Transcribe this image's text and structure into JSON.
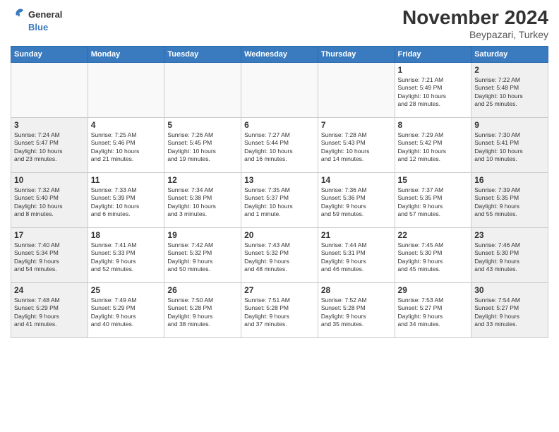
{
  "logo": {
    "general": "General",
    "blue": "Blue"
  },
  "header": {
    "month": "November 2024",
    "location": "Beypazari, Turkey"
  },
  "weekdays": [
    "Sunday",
    "Monday",
    "Tuesday",
    "Wednesday",
    "Thursday",
    "Friday",
    "Saturday"
  ],
  "weeks": [
    [
      {
        "day": "",
        "info": ""
      },
      {
        "day": "",
        "info": ""
      },
      {
        "day": "",
        "info": ""
      },
      {
        "day": "",
        "info": ""
      },
      {
        "day": "",
        "info": ""
      },
      {
        "day": "1",
        "info": "Sunrise: 7:21 AM\nSunset: 5:49 PM\nDaylight: 10 hours\nand 28 minutes."
      },
      {
        "day": "2",
        "info": "Sunrise: 7:22 AM\nSunset: 5:48 PM\nDaylight: 10 hours\nand 25 minutes."
      }
    ],
    [
      {
        "day": "3",
        "info": "Sunrise: 7:24 AM\nSunset: 5:47 PM\nDaylight: 10 hours\nand 23 minutes."
      },
      {
        "day": "4",
        "info": "Sunrise: 7:25 AM\nSunset: 5:46 PM\nDaylight: 10 hours\nand 21 minutes."
      },
      {
        "day": "5",
        "info": "Sunrise: 7:26 AM\nSunset: 5:45 PM\nDaylight: 10 hours\nand 19 minutes."
      },
      {
        "day": "6",
        "info": "Sunrise: 7:27 AM\nSunset: 5:44 PM\nDaylight: 10 hours\nand 16 minutes."
      },
      {
        "day": "7",
        "info": "Sunrise: 7:28 AM\nSunset: 5:43 PM\nDaylight: 10 hours\nand 14 minutes."
      },
      {
        "day": "8",
        "info": "Sunrise: 7:29 AM\nSunset: 5:42 PM\nDaylight: 10 hours\nand 12 minutes."
      },
      {
        "day": "9",
        "info": "Sunrise: 7:30 AM\nSunset: 5:41 PM\nDaylight: 10 hours\nand 10 minutes."
      }
    ],
    [
      {
        "day": "10",
        "info": "Sunrise: 7:32 AM\nSunset: 5:40 PM\nDaylight: 10 hours\nand 8 minutes."
      },
      {
        "day": "11",
        "info": "Sunrise: 7:33 AM\nSunset: 5:39 PM\nDaylight: 10 hours\nand 6 minutes."
      },
      {
        "day": "12",
        "info": "Sunrise: 7:34 AM\nSunset: 5:38 PM\nDaylight: 10 hours\nand 3 minutes."
      },
      {
        "day": "13",
        "info": "Sunrise: 7:35 AM\nSunset: 5:37 PM\nDaylight: 10 hours\nand 1 minute."
      },
      {
        "day": "14",
        "info": "Sunrise: 7:36 AM\nSunset: 5:36 PM\nDaylight: 9 hours\nand 59 minutes."
      },
      {
        "day": "15",
        "info": "Sunrise: 7:37 AM\nSunset: 5:35 PM\nDaylight: 9 hours\nand 57 minutes."
      },
      {
        "day": "16",
        "info": "Sunrise: 7:39 AM\nSunset: 5:35 PM\nDaylight: 9 hours\nand 55 minutes."
      }
    ],
    [
      {
        "day": "17",
        "info": "Sunrise: 7:40 AM\nSunset: 5:34 PM\nDaylight: 9 hours\nand 54 minutes."
      },
      {
        "day": "18",
        "info": "Sunrise: 7:41 AM\nSunset: 5:33 PM\nDaylight: 9 hours\nand 52 minutes."
      },
      {
        "day": "19",
        "info": "Sunrise: 7:42 AM\nSunset: 5:32 PM\nDaylight: 9 hours\nand 50 minutes."
      },
      {
        "day": "20",
        "info": "Sunrise: 7:43 AM\nSunset: 5:32 PM\nDaylight: 9 hours\nand 48 minutes."
      },
      {
        "day": "21",
        "info": "Sunrise: 7:44 AM\nSunset: 5:31 PM\nDaylight: 9 hours\nand 46 minutes."
      },
      {
        "day": "22",
        "info": "Sunrise: 7:45 AM\nSunset: 5:30 PM\nDaylight: 9 hours\nand 45 minutes."
      },
      {
        "day": "23",
        "info": "Sunrise: 7:46 AM\nSunset: 5:30 PM\nDaylight: 9 hours\nand 43 minutes."
      }
    ],
    [
      {
        "day": "24",
        "info": "Sunrise: 7:48 AM\nSunset: 5:29 PM\nDaylight: 9 hours\nand 41 minutes."
      },
      {
        "day": "25",
        "info": "Sunrise: 7:49 AM\nSunset: 5:29 PM\nDaylight: 9 hours\nand 40 minutes."
      },
      {
        "day": "26",
        "info": "Sunrise: 7:50 AM\nSunset: 5:28 PM\nDaylight: 9 hours\nand 38 minutes."
      },
      {
        "day": "27",
        "info": "Sunrise: 7:51 AM\nSunset: 5:28 PM\nDaylight: 9 hours\nand 37 minutes."
      },
      {
        "day": "28",
        "info": "Sunrise: 7:52 AM\nSunset: 5:28 PM\nDaylight: 9 hours\nand 35 minutes."
      },
      {
        "day": "29",
        "info": "Sunrise: 7:53 AM\nSunset: 5:27 PM\nDaylight: 9 hours\nand 34 minutes."
      },
      {
        "day": "30",
        "info": "Sunrise: 7:54 AM\nSunset: 5:27 PM\nDaylight: 9 hours\nand 33 minutes."
      }
    ]
  ]
}
